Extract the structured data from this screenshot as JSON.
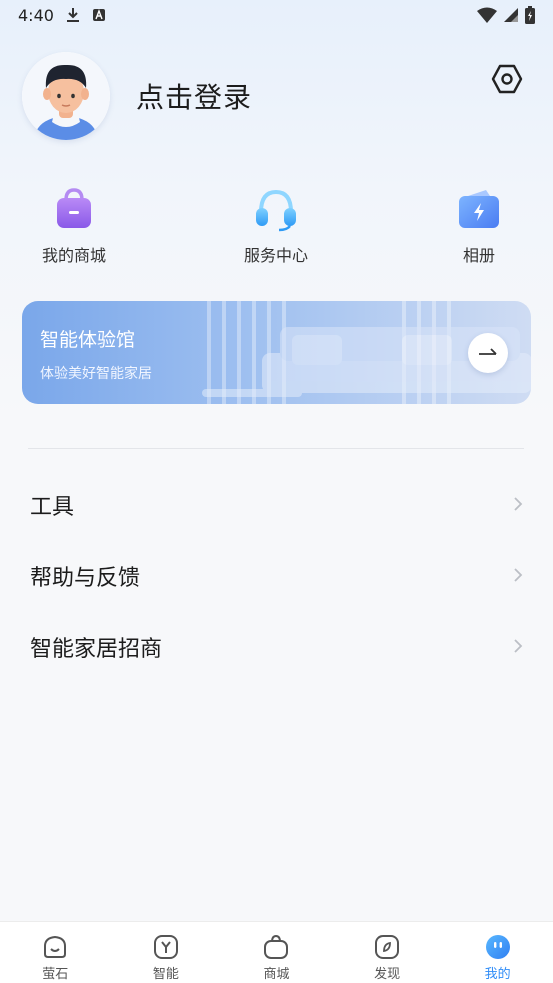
{
  "status_bar": {
    "time": "4:40"
  },
  "profile": {
    "login_text": "点击登录"
  },
  "quick_links": [
    {
      "label": "我的商城",
      "icon": "shopping-bag-icon"
    },
    {
      "label": "服务中心",
      "icon": "headset-icon"
    },
    {
      "label": "相册",
      "icon": "album-icon"
    }
  ],
  "banner": {
    "title": "智能体验馆",
    "subtitle": "体验美好智能家居"
  },
  "menu": [
    {
      "label": "工具"
    },
    {
      "label": "帮助与反馈"
    },
    {
      "label": "智能家居招商"
    }
  ],
  "bottom_nav": [
    {
      "label": "萤石",
      "icon": "home-icon"
    },
    {
      "label": "智能",
      "icon": "smart-icon"
    },
    {
      "label": "商城",
      "icon": "mall-icon"
    },
    {
      "label": "发现",
      "icon": "discover-icon"
    },
    {
      "label": "我的",
      "icon": "profile-icon",
      "active": true
    }
  ],
  "colors": {
    "accent": "#2f8cf7",
    "banner": "#7aa7ea"
  }
}
